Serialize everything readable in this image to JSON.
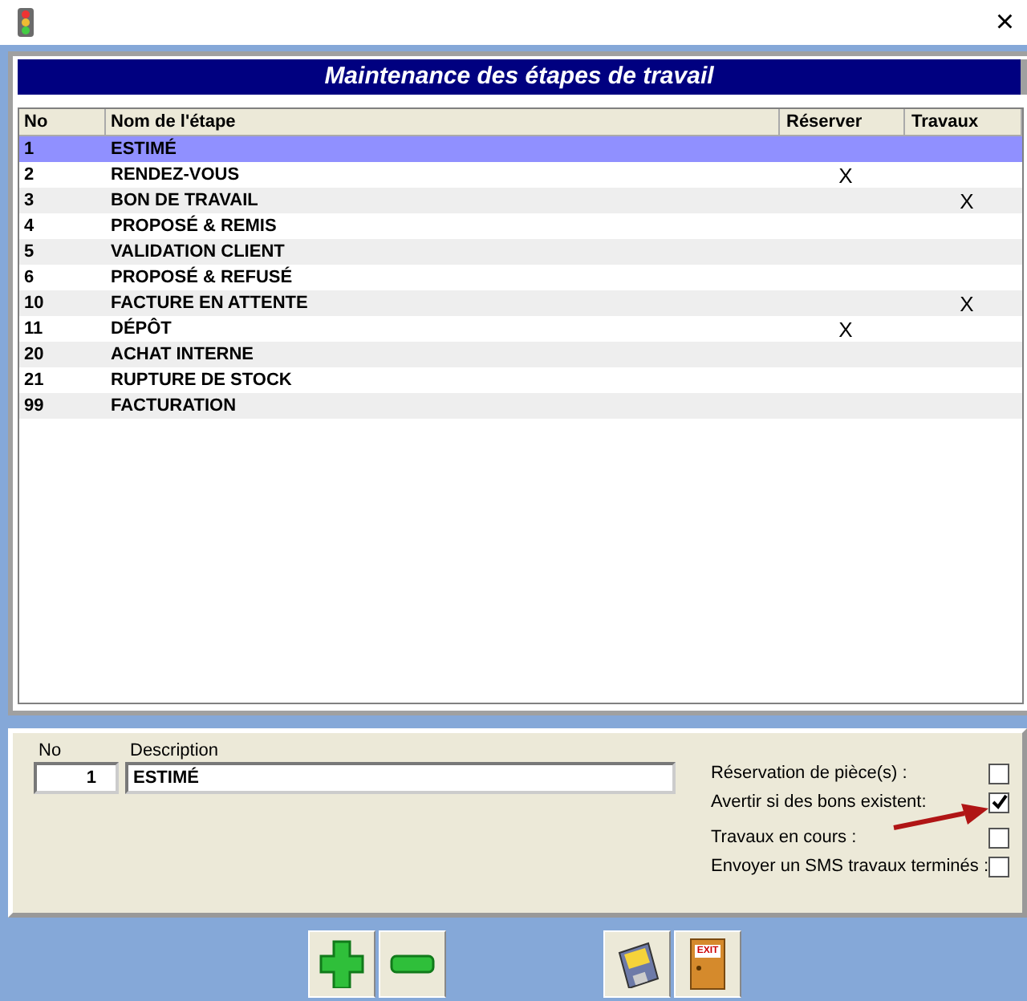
{
  "window": {
    "close": "×"
  },
  "title": "Maintenance des étapes de travail",
  "table": {
    "columns": [
      "No",
      "Nom de l'étape",
      "Réserver",
      "Travaux"
    ],
    "rows": [
      {
        "no": "1",
        "name": "ESTIMÉ",
        "reserver": "",
        "travaux": "",
        "selected": true
      },
      {
        "no": "2",
        "name": "RENDEZ-VOUS",
        "reserver": "X",
        "travaux": "",
        "selected": false
      },
      {
        "no": "3",
        "name": "BON DE TRAVAIL",
        "reserver": "",
        "travaux": "X",
        "selected": false
      },
      {
        "no": "4",
        "name": "PROPOSÉ & REMIS",
        "reserver": "",
        "travaux": "",
        "selected": false
      },
      {
        "no": "5",
        "name": "VALIDATION CLIENT",
        "reserver": "",
        "travaux": "",
        "selected": false
      },
      {
        "no": "6",
        "name": "PROPOSÉ & REFUSÉ",
        "reserver": "",
        "travaux": "",
        "selected": false
      },
      {
        "no": "10",
        "name": "FACTURE EN ATTENTE",
        "reserver": "",
        "travaux": "X",
        "selected": false
      },
      {
        "no": "11",
        "name": "DÉPÔT",
        "reserver": "X",
        "travaux": "",
        "selected": false
      },
      {
        "no": "20",
        "name": "ACHAT INTERNE",
        "reserver": "",
        "travaux": "",
        "selected": false
      },
      {
        "no": "21",
        "name": "RUPTURE DE STOCK",
        "reserver": "",
        "travaux": "",
        "selected": false
      },
      {
        "no": "99",
        "name": "FACTURATION",
        "reserver": "",
        "travaux": "",
        "selected": false
      }
    ]
  },
  "form": {
    "no_label": "No",
    "no_value": "1",
    "description_label": "Description",
    "description_value": "ESTIMÉ",
    "options": [
      {
        "label": "Réservation de pièce(s) :",
        "checked": false
      },
      {
        "label": "Avertir si des bons existent:",
        "checked": true
      },
      {
        "label": "Travaux en cours :",
        "checked": false
      },
      {
        "label": "Envoyer un SMS travaux terminés :",
        "checked": false
      }
    ]
  },
  "exit_sign": "EXIT"
}
